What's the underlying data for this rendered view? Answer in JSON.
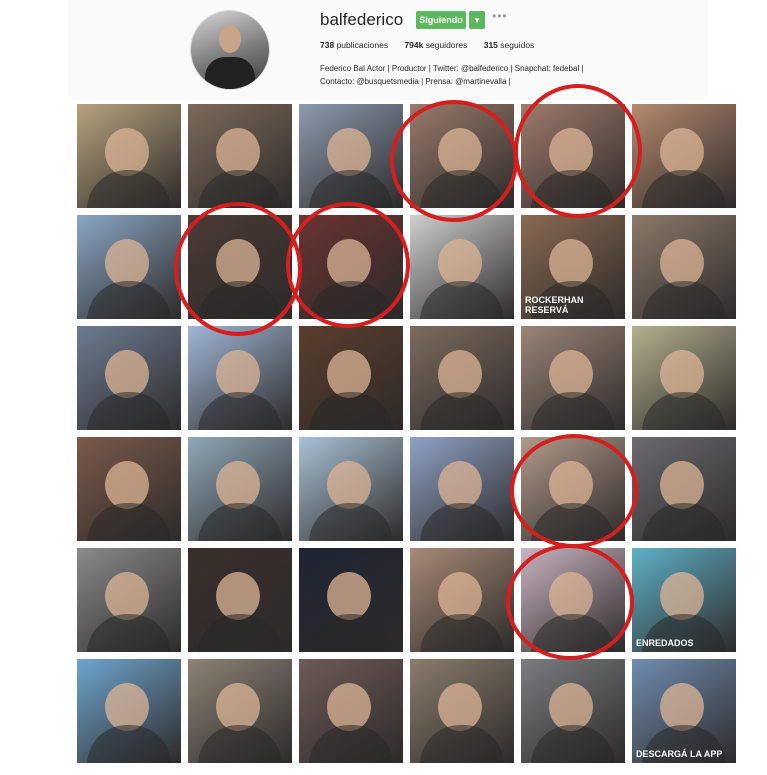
{
  "profile": {
    "username": "balfederico",
    "follow_label": "Siguiendo",
    "dropdown_label": "▾",
    "more_label": "•••",
    "stats": {
      "posts_count": "738",
      "posts_label": "publicaciones",
      "followers_count": "794k",
      "followers_label": "seguidores",
      "following_count": "315",
      "following_label": "seguidos"
    },
    "bio_line1": "Federico Bal Actor | Productor | Twitter: @balfederico | Snapchat: fedebal |",
    "bio_line2": "Contacto: @busquetsmedia | Prensa: @martinevalla |"
  },
  "grid": {
    "tiles": [
      {
        "color": "#b9a37e"
      },
      {
        "color": "#7d6a5a"
      },
      {
        "color": "#8d9bb0"
      },
      {
        "color": "#9a7a6b"
      },
      {
        "color": "#a07c6c"
      },
      {
        "color": "#b68a6e"
      },
      {
        "color": "#8aa7c4"
      },
      {
        "color": "#4b3a34"
      },
      {
        "color": "#6a3331"
      },
      {
        "color": "#cfcfcf"
      },
      {
        "color": "#8a6a52"
      },
      {
        "color": "#8c7a6a"
      },
      {
        "color": "#6d7c92"
      },
      {
        "color": "#9fb7d6"
      },
      {
        "color": "#5a3e2c"
      },
      {
        "color": "#7d6b5e"
      },
      {
        "color": "#9b8578"
      },
      {
        "color": "#b4b08e"
      },
      {
        "color": "#7b5a4a"
      },
      {
        "color": "#8fa8b8"
      },
      {
        "color": "#a9c2d6"
      },
      {
        "color": "#8fa2c6"
      },
      {
        "color": "#b39a8a"
      },
      {
        "color": "#6c6a70"
      },
      {
        "color": "#8b8b8b"
      },
      {
        "color": "#3a2f2c"
      },
      {
        "color": "#1f2434"
      },
      {
        "color": "#a88a76"
      },
      {
        "color": "#c9b3c0"
      },
      {
        "color": "#5fb0c6"
      },
      {
        "color": "#6fa5cf"
      },
      {
        "color": "#8d8376"
      },
      {
        "color": "#6f5a57"
      },
      {
        "color": "#8b7d6c"
      },
      {
        "color": "#7a7d80"
      },
      {
        "color": "#6f8db0"
      }
    ],
    "overlay_texts": {
      "tile_10": "ROCKERHAN RESERVÁ",
      "tile_29": "ENREDADOS",
      "tile_35": "DESCARGÁ LA APP"
    }
  },
  "annotations": {
    "circle_color": "#d51f1f"
  }
}
